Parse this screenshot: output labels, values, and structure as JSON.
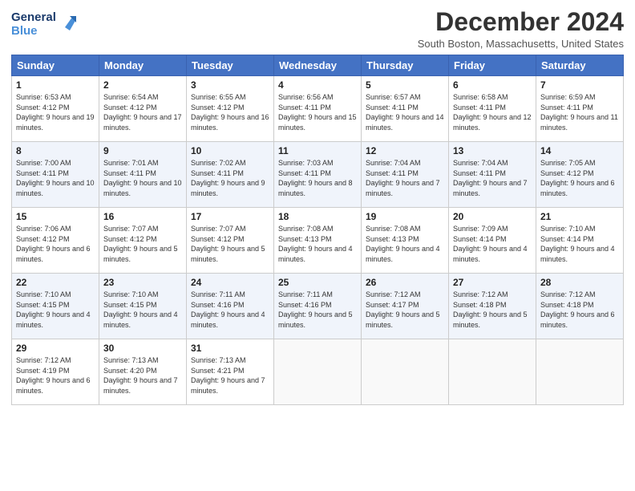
{
  "header": {
    "logo_line1": "General",
    "logo_line2": "Blue",
    "month_title": "December 2024",
    "subtitle": "South Boston, Massachusetts, United States"
  },
  "days_of_week": [
    "Sunday",
    "Monday",
    "Tuesday",
    "Wednesday",
    "Thursday",
    "Friday",
    "Saturday"
  ],
  "weeks": [
    [
      {
        "day": "1",
        "sunrise": "6:53 AM",
        "sunset": "4:12 PM",
        "daylight": "9 hours and 19 minutes."
      },
      {
        "day": "2",
        "sunrise": "6:54 AM",
        "sunset": "4:12 PM",
        "daylight": "9 hours and 17 minutes."
      },
      {
        "day": "3",
        "sunrise": "6:55 AM",
        "sunset": "4:12 PM",
        "daylight": "9 hours and 16 minutes."
      },
      {
        "day": "4",
        "sunrise": "6:56 AM",
        "sunset": "4:11 PM",
        "daylight": "9 hours and 15 minutes."
      },
      {
        "day": "5",
        "sunrise": "6:57 AM",
        "sunset": "4:11 PM",
        "daylight": "9 hours and 14 minutes."
      },
      {
        "day": "6",
        "sunrise": "6:58 AM",
        "sunset": "4:11 PM",
        "daylight": "9 hours and 12 minutes."
      },
      {
        "day": "7",
        "sunrise": "6:59 AM",
        "sunset": "4:11 PM",
        "daylight": "9 hours and 11 minutes."
      }
    ],
    [
      {
        "day": "8",
        "sunrise": "7:00 AM",
        "sunset": "4:11 PM",
        "daylight": "9 hours and 10 minutes."
      },
      {
        "day": "9",
        "sunrise": "7:01 AM",
        "sunset": "4:11 PM",
        "daylight": "9 hours and 10 minutes."
      },
      {
        "day": "10",
        "sunrise": "7:02 AM",
        "sunset": "4:11 PM",
        "daylight": "9 hours and 9 minutes."
      },
      {
        "day": "11",
        "sunrise": "7:03 AM",
        "sunset": "4:11 PM",
        "daylight": "9 hours and 8 minutes."
      },
      {
        "day": "12",
        "sunrise": "7:04 AM",
        "sunset": "4:11 PM",
        "daylight": "9 hours and 7 minutes."
      },
      {
        "day": "13",
        "sunrise": "7:04 AM",
        "sunset": "4:11 PM",
        "daylight": "9 hours and 7 minutes."
      },
      {
        "day": "14",
        "sunrise": "7:05 AM",
        "sunset": "4:12 PM",
        "daylight": "9 hours and 6 minutes."
      }
    ],
    [
      {
        "day": "15",
        "sunrise": "7:06 AM",
        "sunset": "4:12 PM",
        "daylight": "9 hours and 6 minutes."
      },
      {
        "day": "16",
        "sunrise": "7:07 AM",
        "sunset": "4:12 PM",
        "daylight": "9 hours and 5 minutes."
      },
      {
        "day": "17",
        "sunrise": "7:07 AM",
        "sunset": "4:12 PM",
        "daylight": "9 hours and 5 minutes."
      },
      {
        "day": "18",
        "sunrise": "7:08 AM",
        "sunset": "4:13 PM",
        "daylight": "9 hours and 4 minutes."
      },
      {
        "day": "19",
        "sunrise": "7:08 AM",
        "sunset": "4:13 PM",
        "daylight": "9 hours and 4 minutes."
      },
      {
        "day": "20",
        "sunrise": "7:09 AM",
        "sunset": "4:14 PM",
        "daylight": "9 hours and 4 minutes."
      },
      {
        "day": "21",
        "sunrise": "7:10 AM",
        "sunset": "4:14 PM",
        "daylight": "9 hours and 4 minutes."
      }
    ],
    [
      {
        "day": "22",
        "sunrise": "7:10 AM",
        "sunset": "4:15 PM",
        "daylight": "9 hours and 4 minutes."
      },
      {
        "day": "23",
        "sunrise": "7:10 AM",
        "sunset": "4:15 PM",
        "daylight": "9 hours and 4 minutes."
      },
      {
        "day": "24",
        "sunrise": "7:11 AM",
        "sunset": "4:16 PM",
        "daylight": "9 hours and 4 minutes."
      },
      {
        "day": "25",
        "sunrise": "7:11 AM",
        "sunset": "4:16 PM",
        "daylight": "9 hours and 5 minutes."
      },
      {
        "day": "26",
        "sunrise": "7:12 AM",
        "sunset": "4:17 PM",
        "daylight": "9 hours and 5 minutes."
      },
      {
        "day": "27",
        "sunrise": "7:12 AM",
        "sunset": "4:18 PM",
        "daylight": "9 hours and 5 minutes."
      },
      {
        "day": "28",
        "sunrise": "7:12 AM",
        "sunset": "4:18 PM",
        "daylight": "9 hours and 6 minutes."
      }
    ],
    [
      {
        "day": "29",
        "sunrise": "7:12 AM",
        "sunset": "4:19 PM",
        "daylight": "9 hours and 6 minutes."
      },
      {
        "day": "30",
        "sunrise": "7:13 AM",
        "sunset": "4:20 PM",
        "daylight": "9 hours and 7 minutes."
      },
      {
        "day": "31",
        "sunrise": "7:13 AM",
        "sunset": "4:21 PM",
        "daylight": "9 hours and 7 minutes."
      },
      null,
      null,
      null,
      null
    ]
  ],
  "labels": {
    "sunrise": "Sunrise:",
    "sunset": "Sunset:",
    "daylight": "Daylight:"
  }
}
